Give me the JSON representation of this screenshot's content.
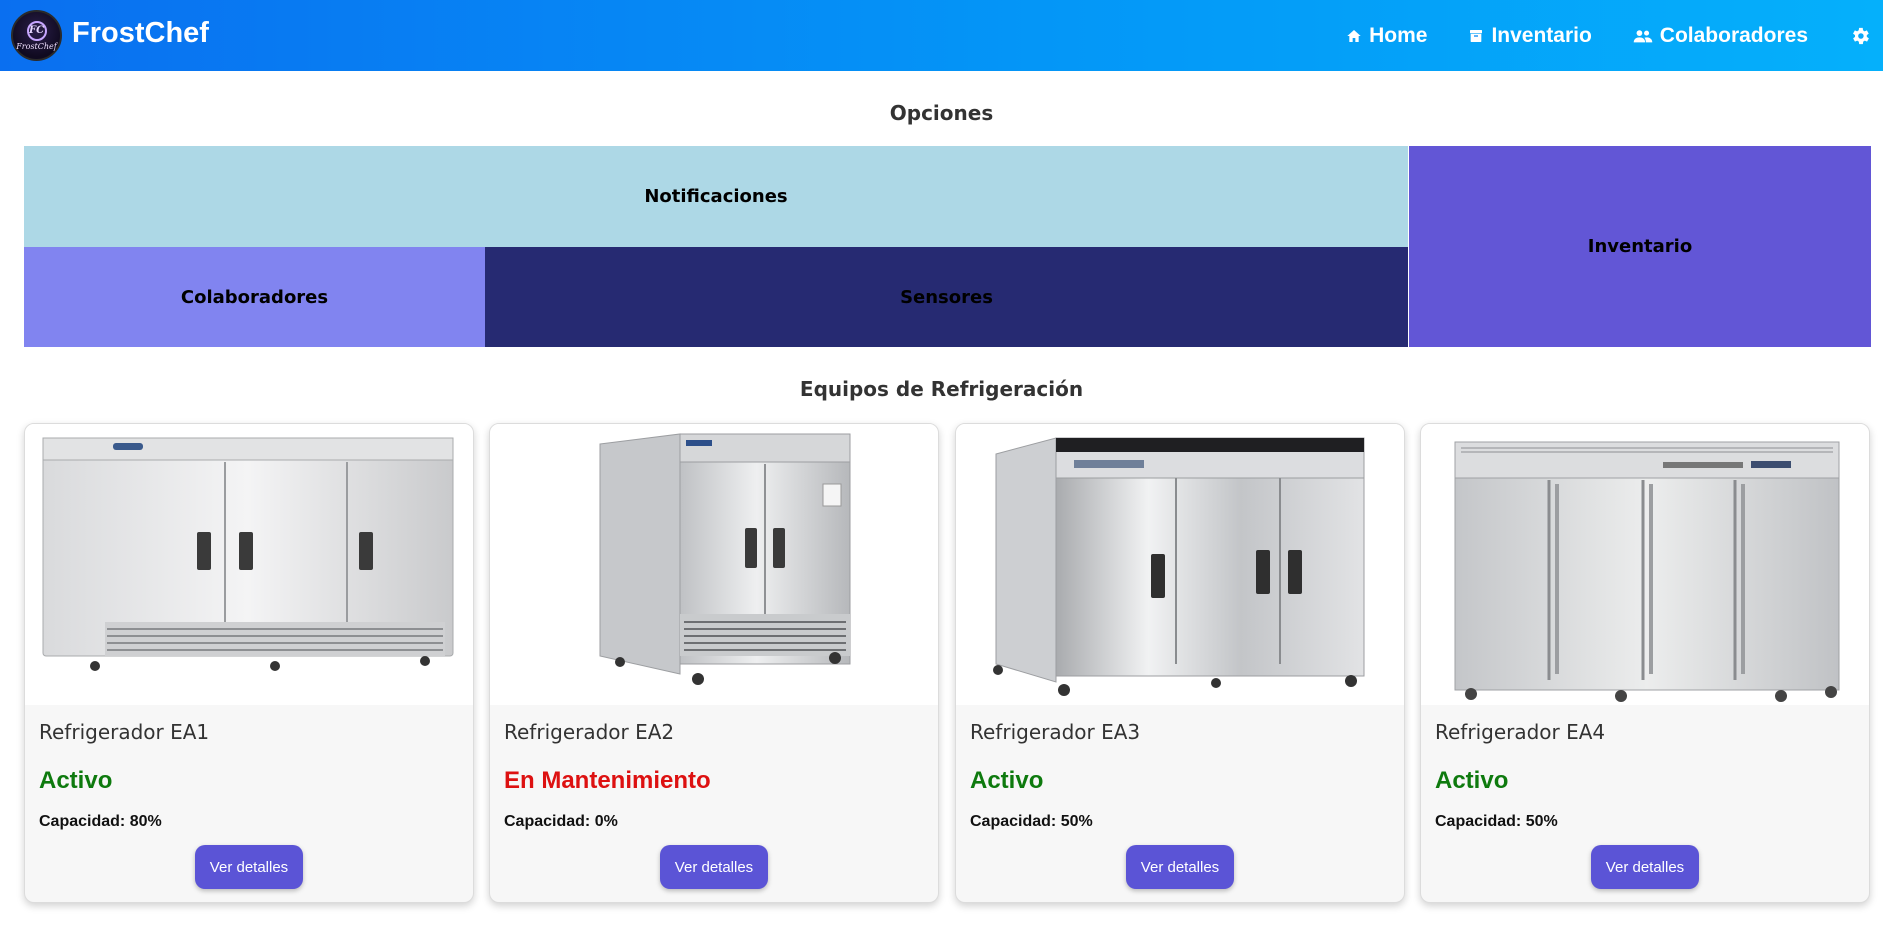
{
  "header": {
    "brand": "FrostChef",
    "logo_initials": "FC",
    "logo_script": "FrostChef",
    "nav": [
      {
        "label": "Home",
        "icon": "home-icon"
      },
      {
        "label": "Inventario",
        "icon": "archive-icon"
      },
      {
        "label": "Colaboradores",
        "icon": "people-icon"
      }
    ],
    "settings_icon": "gear-icon"
  },
  "options": {
    "title": "Opciones",
    "tiles": {
      "notificaciones": {
        "label": "Notificaciones",
        "color": "#add8e6"
      },
      "colaboradores": {
        "label": "Colaboradores",
        "color": "#8184f0"
      },
      "sensores": {
        "label": "Sensores",
        "color": "#262a72"
      },
      "inventario": {
        "label": "Inventario",
        "color": "#6256d6"
      }
    }
  },
  "equipment": {
    "title": "Equipos de Refrigeración",
    "cards": [
      {
        "name": "Refrigerador EA1",
        "status": "Activo",
        "status_color": "#0e7a0e",
        "capacity_label": "Capacidad:",
        "capacity": "80%",
        "button": "Ver detalles"
      },
      {
        "name": "Refrigerador EA2",
        "status": "En Mantenimiento",
        "status_color": "#dd1111",
        "capacity_label": "Capacidad:",
        "capacity": "0%",
        "button": "Ver detalles"
      },
      {
        "name": "Refrigerador EA3",
        "status": "Activo",
        "status_color": "#0e7a0e",
        "capacity_label": "Capacidad:",
        "capacity": "50%",
        "button": "Ver detalles"
      },
      {
        "name": "Refrigerador EA4",
        "status": "Activo",
        "status_color": "#0e7a0e",
        "capacity_label": "Capacidad:",
        "capacity": "50%",
        "button": "Ver detalles"
      }
    ]
  },
  "colors": {
    "header_start": "#0a6ff0",
    "header_end": "#05b0fb",
    "button": "#5b54d6"
  }
}
